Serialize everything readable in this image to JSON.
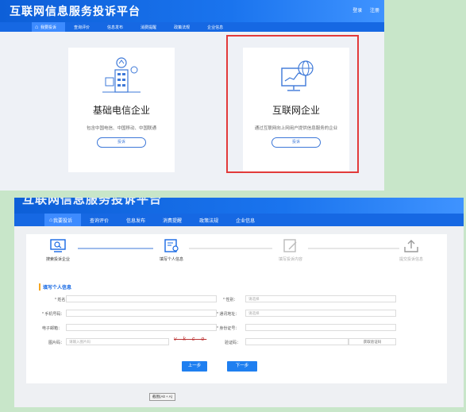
{
  "app_title": "互联网信息服务投诉平台",
  "header_links": [
    "登录",
    "注册"
  ],
  "nav": [
    "我要投诉",
    "查询评价",
    "信息发布",
    "消费提醒",
    "政策法规",
    "企业信息"
  ],
  "cards": [
    {
      "title": "基础电信企业",
      "desc": "包含中国电信、中国移动、中国联通",
      "button": "投诉"
    },
    {
      "title": "互联网企业",
      "desc": "通过互联网向上网用户提供信息服务的企业",
      "button": "投诉"
    }
  ],
  "steps": [
    "搜索投诉企业",
    "填写个人信息",
    "填写投诉内容",
    "提交投诉信息"
  ],
  "section_title": "填写个人信息",
  "form": {
    "name_label": "* 姓名：",
    "gender_label": "* 性别：",
    "gender_placeholder": "请选择",
    "phone_label": "* 手机号码：",
    "address_label": "* 通讯地址：",
    "address_placeholder": "请选择",
    "email_label": "电子邮箱：",
    "idcard_label": "* 身份证号：",
    "captcha_label": "图片码：",
    "captcha_placeholder": "请输入图片码",
    "captcha_image": "v k c o",
    "sms_label": "验证码：",
    "sms_button": "获取验证码"
  },
  "buttons": {
    "prev": "上一步",
    "next": "下一步"
  },
  "zoom_hint": "截图(Alt + A)",
  "colors": {
    "brand": "#1668e3",
    "highlight": "#e23a3a",
    "accent": "#f5a623"
  }
}
